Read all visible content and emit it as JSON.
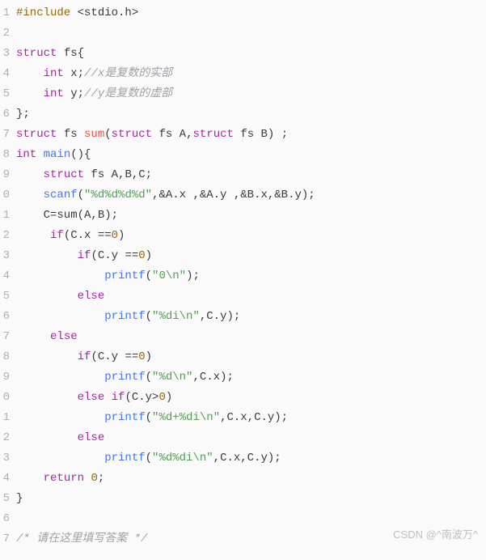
{
  "gutter": [
    "1",
    "2",
    "3",
    "4",
    "5",
    "6",
    "7",
    "8",
    "9",
    "0",
    "1",
    "2",
    "3",
    "4",
    "5",
    "6",
    "7",
    "8",
    "9",
    "0",
    "1",
    "2",
    "3",
    "4",
    "5",
    "6",
    "7"
  ],
  "lines": [
    [
      {
        "cls": "c-pre",
        "t": "#include"
      },
      {
        "cls": "c-punc",
        "t": " <stdio.h>"
      }
    ],
    [],
    [
      {
        "cls": "c-kw",
        "t": "struct"
      },
      {
        "cls": "c-punc",
        "t": " fs{"
      }
    ],
    [
      {
        "cls": "c-punc",
        "t": "    "
      },
      {
        "cls": "c-kw",
        "t": "int"
      },
      {
        "cls": "c-punc",
        "t": " x;"
      },
      {
        "cls": "c-cmt",
        "t": "//x是复数的实部"
      }
    ],
    [
      {
        "cls": "c-punc",
        "t": "    "
      },
      {
        "cls": "c-kw",
        "t": "int"
      },
      {
        "cls": "c-punc",
        "t": " y;"
      },
      {
        "cls": "c-cmt",
        "t": "//y是复数的虚部"
      }
    ],
    [
      {
        "cls": "c-punc",
        "t": "};"
      }
    ],
    [
      {
        "cls": "c-kw",
        "t": "struct"
      },
      {
        "cls": "c-punc",
        "t": " fs "
      },
      {
        "cls": "c-red",
        "t": "sum"
      },
      {
        "cls": "c-punc",
        "t": "("
      },
      {
        "cls": "c-kw",
        "t": "struct"
      },
      {
        "cls": "c-punc",
        "t": " fs A,"
      },
      {
        "cls": "c-kw",
        "t": "struct"
      },
      {
        "cls": "c-punc",
        "t": " fs B) ;"
      }
    ],
    [
      {
        "cls": "c-kw",
        "t": "int"
      },
      {
        "cls": "c-punc",
        "t": " "
      },
      {
        "cls": "c-fn",
        "t": "main"
      },
      {
        "cls": "c-punc",
        "t": "(){"
      }
    ],
    [
      {
        "cls": "c-punc",
        "t": "    "
      },
      {
        "cls": "c-kw",
        "t": "struct"
      },
      {
        "cls": "c-punc",
        "t": " fs A,B,C;"
      }
    ],
    [
      {
        "cls": "c-punc",
        "t": "    "
      },
      {
        "cls": "c-fn",
        "t": "scanf"
      },
      {
        "cls": "c-punc",
        "t": "("
      },
      {
        "cls": "c-str",
        "t": "\"%d%d%d%d\""
      },
      {
        "cls": "c-punc",
        "t": ",&A.x ,&A.y ,&B.x,&B.y);"
      }
    ],
    [
      {
        "cls": "c-punc",
        "t": "    C=sum(A,B);"
      }
    ],
    [
      {
        "cls": "c-punc",
        "t": "     "
      },
      {
        "cls": "c-kw",
        "t": "if"
      },
      {
        "cls": "c-punc",
        "t": "(C.x =="
      },
      {
        "cls": "c-num",
        "t": "0"
      },
      {
        "cls": "c-punc",
        "t": ")"
      }
    ],
    [
      {
        "cls": "c-punc",
        "t": "         "
      },
      {
        "cls": "c-kw",
        "t": "if"
      },
      {
        "cls": "c-punc",
        "t": "(C.y =="
      },
      {
        "cls": "c-num",
        "t": "0"
      },
      {
        "cls": "c-punc",
        "t": ")"
      }
    ],
    [
      {
        "cls": "c-punc",
        "t": "             "
      },
      {
        "cls": "c-fn",
        "t": "printf"
      },
      {
        "cls": "c-punc",
        "t": "("
      },
      {
        "cls": "c-str",
        "t": "\"0\\n\""
      },
      {
        "cls": "c-punc",
        "t": ");"
      }
    ],
    [
      {
        "cls": "c-punc",
        "t": "         "
      },
      {
        "cls": "c-kw",
        "t": "else"
      }
    ],
    [
      {
        "cls": "c-punc",
        "t": "             "
      },
      {
        "cls": "c-fn",
        "t": "printf"
      },
      {
        "cls": "c-punc",
        "t": "("
      },
      {
        "cls": "c-str",
        "t": "\"%di\\n\""
      },
      {
        "cls": "c-punc",
        "t": ",C.y);"
      }
    ],
    [
      {
        "cls": "c-punc",
        "t": "     "
      },
      {
        "cls": "c-kw",
        "t": "else"
      }
    ],
    [
      {
        "cls": "c-punc",
        "t": "         "
      },
      {
        "cls": "c-kw",
        "t": "if"
      },
      {
        "cls": "c-punc",
        "t": "(C.y =="
      },
      {
        "cls": "c-num",
        "t": "0"
      },
      {
        "cls": "c-punc",
        "t": ")"
      }
    ],
    [
      {
        "cls": "c-punc",
        "t": "             "
      },
      {
        "cls": "c-fn",
        "t": "printf"
      },
      {
        "cls": "c-punc",
        "t": "("
      },
      {
        "cls": "c-str",
        "t": "\"%d\\n\""
      },
      {
        "cls": "c-punc",
        "t": ",C.x);"
      }
    ],
    [
      {
        "cls": "c-punc",
        "t": "         "
      },
      {
        "cls": "c-kw",
        "t": "else"
      },
      {
        "cls": "c-punc",
        "t": " "
      },
      {
        "cls": "c-kw",
        "t": "if"
      },
      {
        "cls": "c-punc",
        "t": "(C.y>"
      },
      {
        "cls": "c-num",
        "t": "0"
      },
      {
        "cls": "c-punc",
        "t": ")"
      }
    ],
    [
      {
        "cls": "c-punc",
        "t": "             "
      },
      {
        "cls": "c-fn",
        "t": "printf"
      },
      {
        "cls": "c-punc",
        "t": "("
      },
      {
        "cls": "c-str",
        "t": "\"%d+%di\\n\""
      },
      {
        "cls": "c-punc",
        "t": ",C.x,C.y);"
      }
    ],
    [
      {
        "cls": "c-punc",
        "t": "         "
      },
      {
        "cls": "c-kw",
        "t": "else"
      }
    ],
    [
      {
        "cls": "c-punc",
        "t": "             "
      },
      {
        "cls": "c-fn",
        "t": "printf"
      },
      {
        "cls": "c-punc",
        "t": "("
      },
      {
        "cls": "c-str",
        "t": "\"%d%di\\n\""
      },
      {
        "cls": "c-punc",
        "t": ",C.x,C.y);"
      }
    ],
    [
      {
        "cls": "c-punc",
        "t": "    "
      },
      {
        "cls": "c-kw",
        "t": "return"
      },
      {
        "cls": "c-punc",
        "t": " "
      },
      {
        "cls": "c-num",
        "t": "0"
      },
      {
        "cls": "c-punc",
        "t": ";"
      }
    ],
    [
      {
        "cls": "c-punc",
        "t": "}"
      }
    ],
    [],
    [
      {
        "cls": "c-cmt",
        "t": "/* 请在这里填写答案 */"
      }
    ]
  ],
  "watermark": "CSDN @^南波万^"
}
